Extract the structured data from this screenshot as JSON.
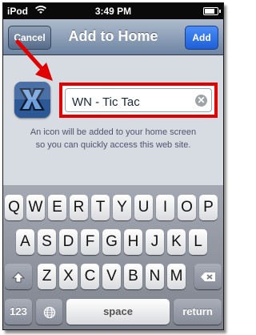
{
  "status_bar": {
    "carrier": "iPod",
    "wifi_icon": "wifi-icon",
    "time": "3:49 PM",
    "battery_icon": "battery-icon"
  },
  "nav": {
    "title": "Add to Home",
    "cancel_label": "Cancel",
    "add_label": "Add"
  },
  "bookmark": {
    "icon": "app-icon",
    "name_value": "WN - Tic Tac",
    "clear_icon": "clear-icon"
  },
  "description_lines": [
    "An icon will be added to your home screen",
    "so you can quickly access this web site."
  ],
  "annotations": {
    "arrow_color": "#e00000",
    "highlight_color": "#e00000"
  },
  "keyboard": {
    "row1": [
      "Q",
      "W",
      "E",
      "R",
      "T",
      "Y",
      "U",
      "I",
      "O",
      "P"
    ],
    "row2": [
      "A",
      "S",
      "D",
      "F",
      "G",
      "H",
      "J",
      "K",
      "L"
    ],
    "row3": [
      "Z",
      "X",
      "C",
      "V",
      "B",
      "N",
      "M"
    ],
    "shift_icon": "shift-icon",
    "delete_icon": "delete-icon",
    "numbers_label": "123",
    "globe_icon": "globe-icon",
    "space_label": "space",
    "return_label": "return"
  }
}
